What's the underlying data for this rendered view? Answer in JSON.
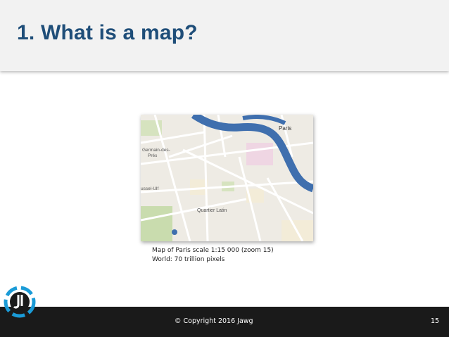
{
  "slide": {
    "title": "1. What is a map?",
    "caption_line1": "Map of Paris scale 1:15 000 (zoom 15)",
    "caption_line2": "World: 70 trillion pixels",
    "page_number": "15"
  },
  "map": {
    "label_paris": "Paris",
    "label_quartier": "Quartier Latin",
    "label_germain": "Germain-des-",
    "label_pres": "Prés",
    "label_ussel": "ussel-Ulf",
    "colors": {
      "land": "#eeebe4",
      "river": "#3f6fae",
      "park": "#c9dcae",
      "road": "#ffffff"
    }
  },
  "footer": {
    "copyright": "© Copyright 2016 Jawg"
  },
  "logo": {
    "icon": "jawg-logo-icon"
  }
}
